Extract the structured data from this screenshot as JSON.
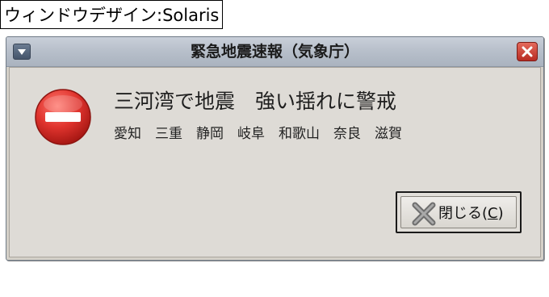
{
  "caption": "ウィンドウデザイン:Solaris",
  "window": {
    "title": "緊急地震速報（気象庁）"
  },
  "dialog": {
    "headline": "三河湾で地震　強い揺れに警戒",
    "regions": "愛知　三重　静岡　岐阜　和歌山　奈良　滋賀",
    "close_button": {
      "label_prefix": "閉じる(",
      "mnemonic": "C",
      "label_suffix": ")"
    }
  },
  "icons": {
    "window_menu": "menu-arrow-icon",
    "window_close": "close-x-icon",
    "dialog_type": "stop-error-icon",
    "button": "close-x-icon"
  },
  "colors": {
    "titlebar": "#b8c0cb",
    "close_button_red": "#c9372c",
    "stop_icon_red": "#e0342e",
    "dialog_background": "#dedbd6"
  }
}
